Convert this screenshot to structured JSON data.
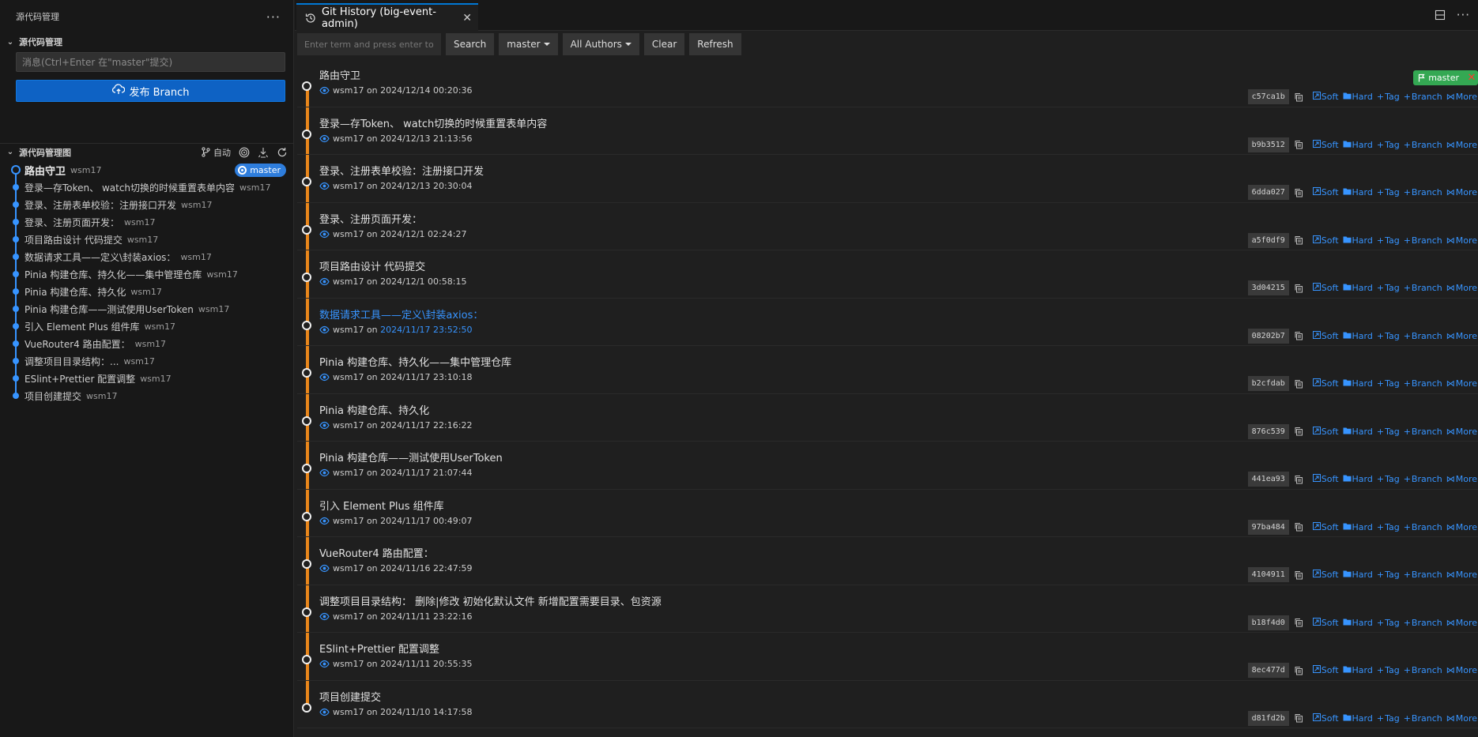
{
  "sidebar": {
    "title": "源代码管理",
    "scm_section": "源代码管理",
    "message_placeholder": "消息(Ctrl+Enter 在\"master\"提交)",
    "publish_label": "发布 Branch",
    "graph_section": "源代码管理图",
    "auto_label": "自动",
    "graph": [
      {
        "message": "路由守卫",
        "author": "wsm17",
        "head": true
      },
      {
        "message": "登录—存Token、 watch切换的时候重置表单内容",
        "author": "wsm17"
      },
      {
        "message": "登录、注册表单校验：注册接口开发",
        "author": "wsm17"
      },
      {
        "message": "登录、注册页面开发：",
        "author": "wsm17"
      },
      {
        "message": " 项目路由设计 代码提交",
        "author": "wsm17"
      },
      {
        "message": "数据请求工具——定义\\封装axios：",
        "author": "wsm17"
      },
      {
        "message": "Pinia 构建仓库、持久化——集中管理仓库",
        "author": "wsm17"
      },
      {
        "message": "Pinia 构建仓库、持久化",
        "author": "wsm17"
      },
      {
        "message": "Pinia 构建仓库——测试使用UserToken",
        "author": "wsm17"
      },
      {
        "message": "引入 Element Plus 组件库",
        "author": "wsm17"
      },
      {
        "message": "VueRouter4 路由配置：",
        "author": "wsm17"
      },
      {
        "message": "调整项目目录结构：...",
        "author": "wsm17"
      },
      {
        "message": "ESlint+Prettier 配置调整",
        "author": "wsm17"
      },
      {
        "message": "项目创建提交",
        "author": "wsm17"
      }
    ],
    "head_branch": "master"
  },
  "tab": {
    "title": "Git History (big-event-admin)"
  },
  "toolbar": {
    "search_placeholder": "Enter term and press enter to search",
    "search": "Search",
    "branch": "master",
    "authors": "All Authors",
    "clear": "Clear",
    "refresh": "Refresh"
  },
  "actions": {
    "soft": "Soft",
    "hard": "Hard",
    "tag": "Tag",
    "branch": "Branch",
    "more": "More"
  },
  "ref_badge": "master",
  "commits": [
    {
      "message": "路由守卫",
      "author": "wsm17",
      "on": "on",
      "date": "2024/12/14 00:20:36",
      "hash": "c57ca1b"
    },
    {
      "message": "登录—存Token、 watch切换的时候重置表单内容",
      "author": "wsm17",
      "on": "on",
      "date": "2024/12/13 21:13:56",
      "hash": "b9b3512"
    },
    {
      "message": "登录、注册表单校验：注册接口开发",
      "author": "wsm17",
      "on": "on",
      "date": "2024/12/13 20:30:04",
      "hash": "6dda027"
    },
    {
      "message": "登录、注册页面开发：",
      "author": "wsm17",
      "on": "on",
      "date": "2024/12/1 02:24:27",
      "hash": "a5f0df9"
    },
    {
      "message": "项目路由设计 代码提交",
      "author": "wsm17",
      "on": "on",
      "date": "2024/12/1 00:58:15",
      "hash": "3d04215"
    },
    {
      "message": "数据请求工具——定义\\封装axios：",
      "author": "wsm17",
      "on": "on",
      "date": "2024/11/17 23:52:50",
      "hash": "08202b7"
    },
    {
      "message": "Pinia 构建仓库、持久化——集中管理仓库",
      "author": "wsm17",
      "on": "on",
      "date": "2024/11/17 23:10:18",
      "hash": "b2cfdab"
    },
    {
      "message": "Pinia 构建仓库、持久化",
      "author": "wsm17",
      "on": "on",
      "date": "2024/11/17 22:16:22",
      "hash": "876c539"
    },
    {
      "message": "Pinia 构建仓库——测试使用UserToken",
      "author": "wsm17",
      "on": "on",
      "date": "2024/11/17 21:07:44",
      "hash": "441ea93"
    },
    {
      "message": "引入 Element Plus 组件库",
      "author": "wsm17",
      "on": "on",
      "date": "2024/11/17 00:49:07",
      "hash": "97ba484"
    },
    {
      "message": "VueRouter4 路由配置：",
      "author": "wsm17",
      "on": "on",
      "date": "2024/11/16 22:47:59",
      "hash": "4104911"
    },
    {
      "message": "调整项目目录结构： 删除|修改 初始化默认文件 新增配置需要目录、包资源",
      "author": "wsm17",
      "on": "on",
      "date": "2024/11/11 23:22:16",
      "hash": "b18f4d0"
    },
    {
      "message": "ESlint+Prettier 配置调整",
      "author": "wsm17",
      "on": "on",
      "date": "2024/11/11 20:55:35",
      "hash": "8ec477d"
    },
    {
      "message": "项目创建提交",
      "author": "wsm17",
      "on": "on",
      "date": "2024/11/10 14:17:58",
      "hash": "d81fd2b"
    }
  ],
  "colors": {
    "accent": "#3794ff",
    "graph_line": "#e8861b",
    "ref_badge": "#34a853",
    "publish": "#0e62c4"
  }
}
